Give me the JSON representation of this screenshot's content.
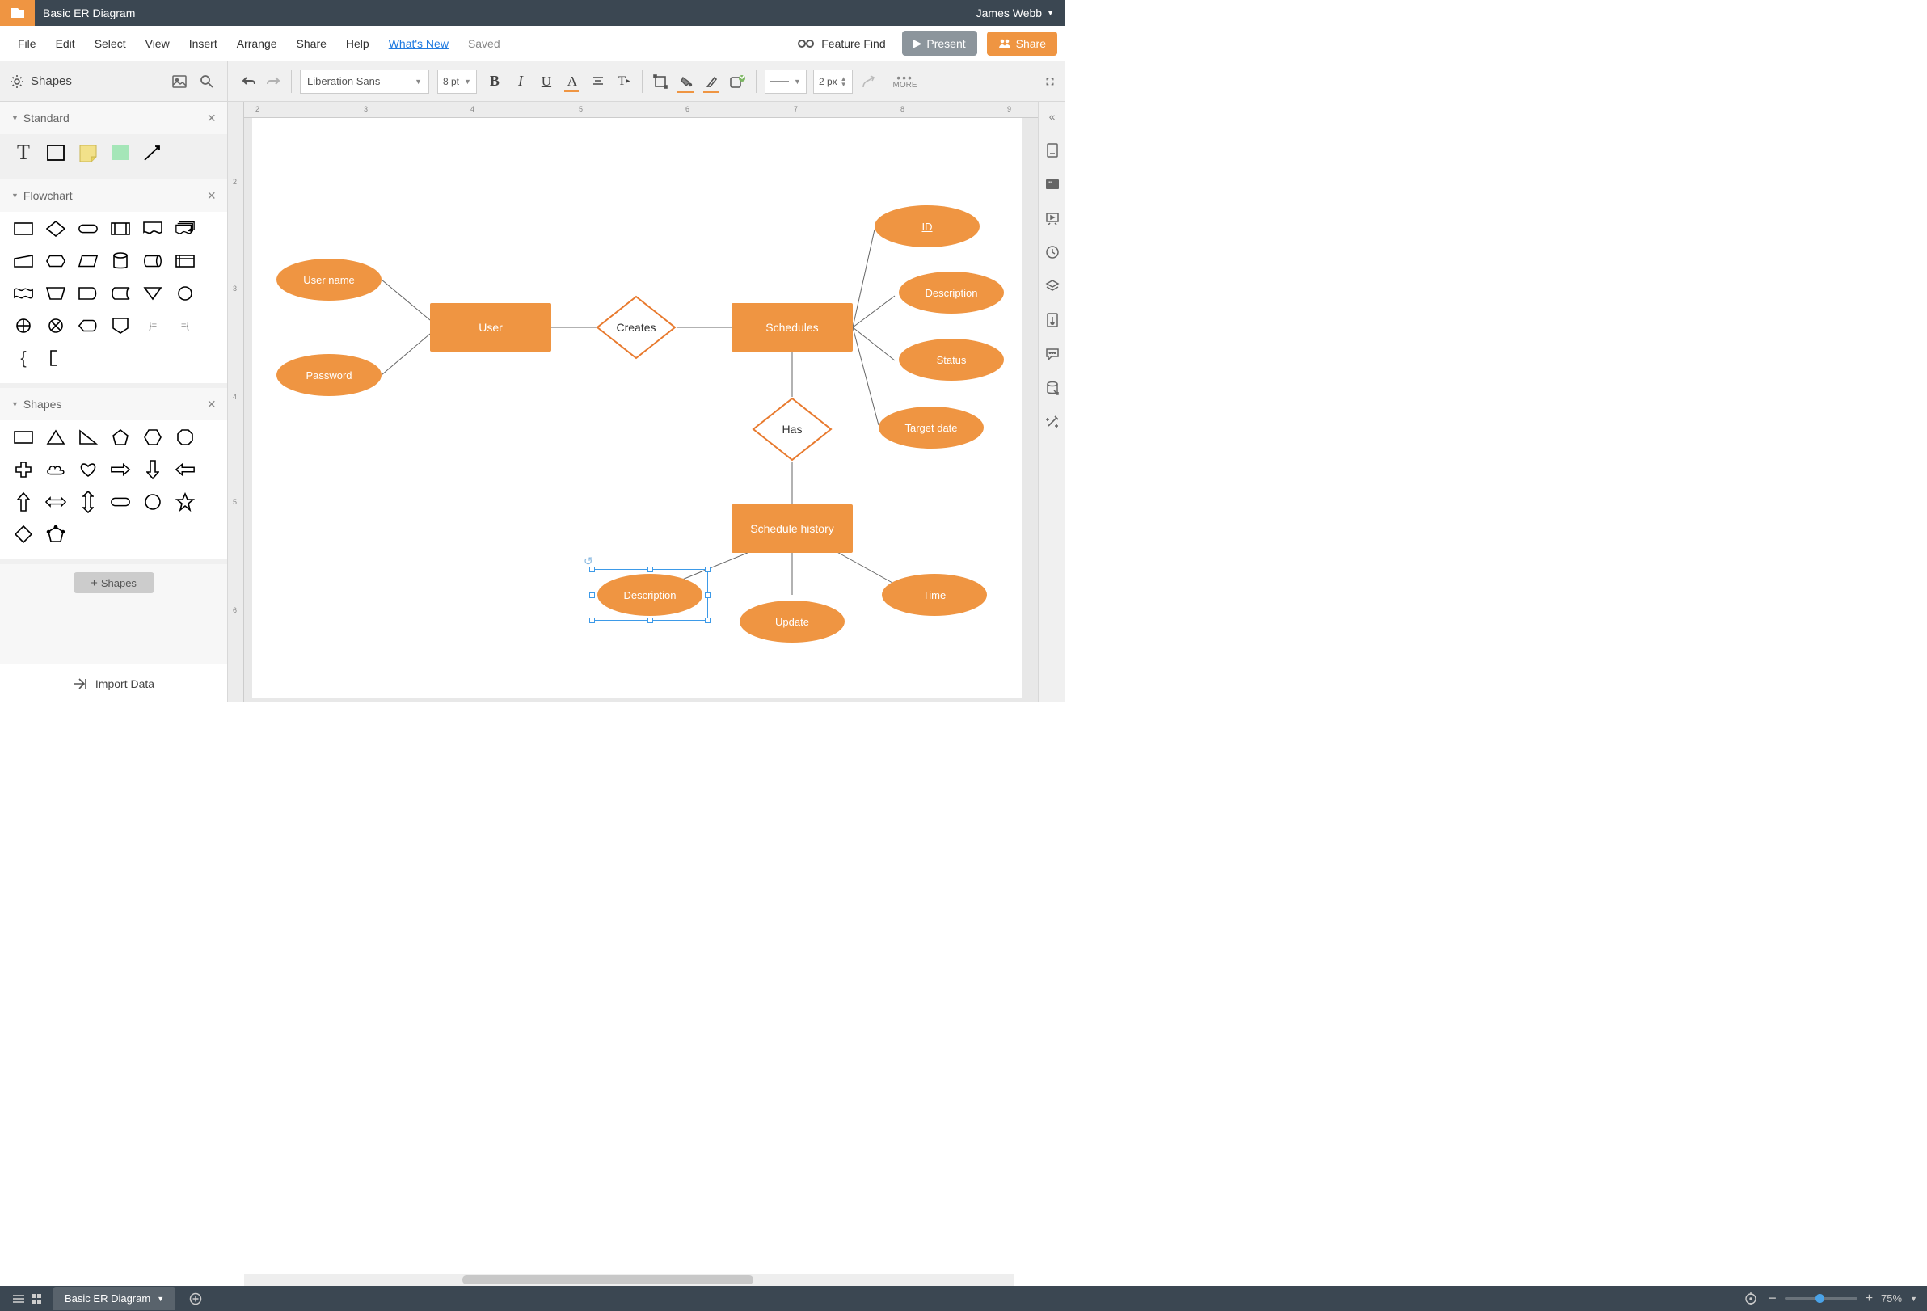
{
  "app": {
    "title": "Basic ER Diagram",
    "user": "James Webb"
  },
  "menu": {
    "items": [
      "File",
      "Edit",
      "Select",
      "View",
      "Insert",
      "Arrange",
      "Share",
      "Help"
    ],
    "whatsnew": "What's New",
    "saved": "Saved",
    "featurefind": "Feature Find",
    "present": "Present",
    "share": "Share"
  },
  "toolbar": {
    "shapes_label": "Shapes",
    "font": "Liberation Sans",
    "size": "8 pt",
    "line_width": "2 px",
    "more": "MORE"
  },
  "panel": {
    "categories": [
      {
        "name": "Standard"
      },
      {
        "name": "Flowchart"
      },
      {
        "name": "Shapes"
      }
    ],
    "add_shapes": "Shapes",
    "import": "Import Data"
  },
  "canvas": {
    "hruler": [
      "2",
      "3",
      "4",
      "5",
      "6",
      "7",
      "8",
      "9"
    ],
    "vruler": [
      "2",
      "3",
      "4",
      "5",
      "6"
    ],
    "entities": {
      "user": "User",
      "schedules": "Schedules",
      "schedule_history": "Schedule history"
    },
    "relationships": {
      "creates": "Creates",
      "has": "Has"
    },
    "attributes": {
      "username": "User name",
      "password": "Password",
      "id": "ID",
      "description": "Description",
      "status": "Status",
      "target_date": "Target date",
      "description2": "Description",
      "update": "Update",
      "time": "Time"
    }
  },
  "tabs": {
    "primary": "Basic ER Diagram"
  },
  "zoom": {
    "level": "75%"
  }
}
